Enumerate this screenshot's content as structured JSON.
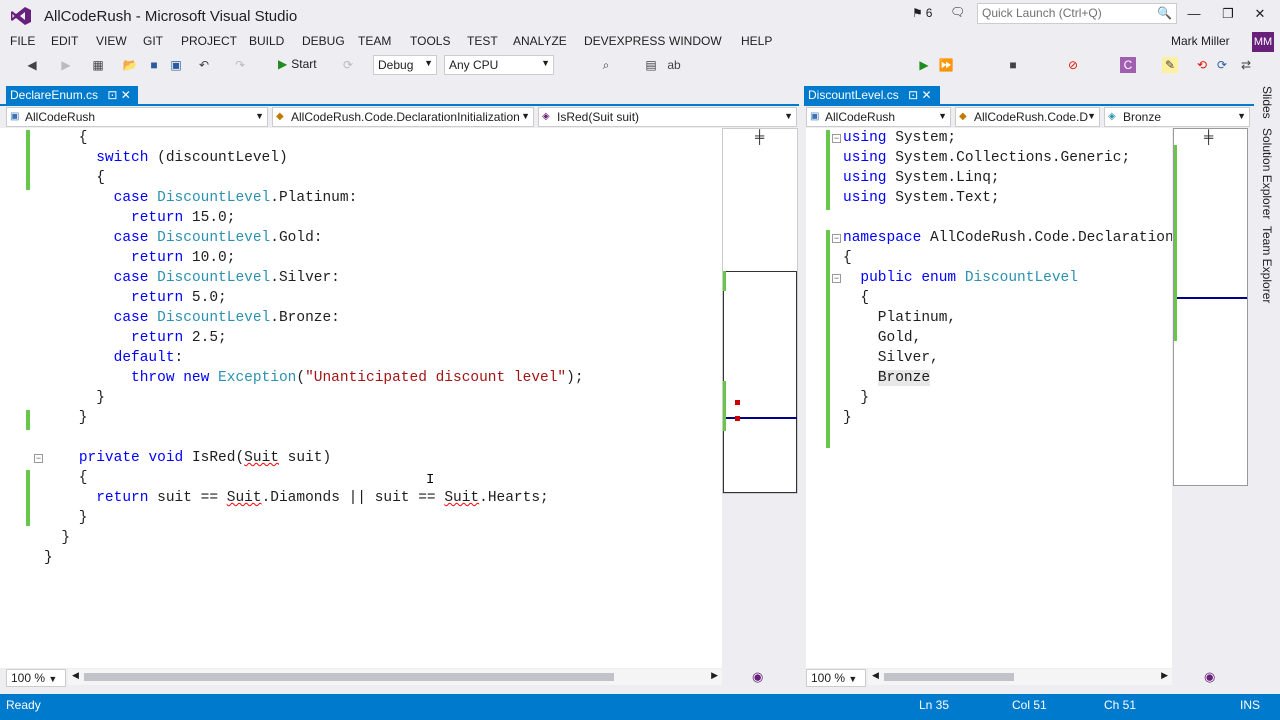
{
  "window": {
    "title": "AllCodeRush - Microsoft Visual Studio",
    "notification_count": "6",
    "quick_launch_placeholder": "Quick Launch (Ctrl+Q)",
    "user_name": "Mark Miller",
    "user_initials": "MM"
  },
  "menu": [
    "FILE",
    "EDIT",
    "VIEW",
    "GIT",
    "PROJECT",
    "BUILD",
    "DEBUG",
    "TEAM",
    "TOOLS",
    "TEST",
    "ANALYZE",
    "DEVEXPRESS",
    "WINDOW",
    "HELP"
  ],
  "toolbar": {
    "start_label": "Start",
    "config": "Debug",
    "platform": "Any CPU"
  },
  "left_editor": {
    "tab": "DeclareEnum.cs",
    "nav": {
      "project": "AllCodeRush",
      "type": "AllCodeRush.Code.DeclarationInitialization",
      "member": "IsRed(Suit suit)"
    },
    "zoom": "100 %"
  },
  "right_editor": {
    "tab": "DiscountLevel.cs",
    "nav": {
      "project": "AllCodeRush",
      "type": "AllCodeRush.Code.D",
      "member": "Bronze"
    },
    "zoom": "100 %"
  },
  "sidebar": {
    "tabs": [
      "Slides",
      "Solution Explorer",
      "Team Explorer"
    ]
  },
  "status": {
    "ready": "Ready",
    "ln": "Ln 35",
    "col": "Col 51",
    "ch": "Ch 51",
    "ins": "INS"
  }
}
